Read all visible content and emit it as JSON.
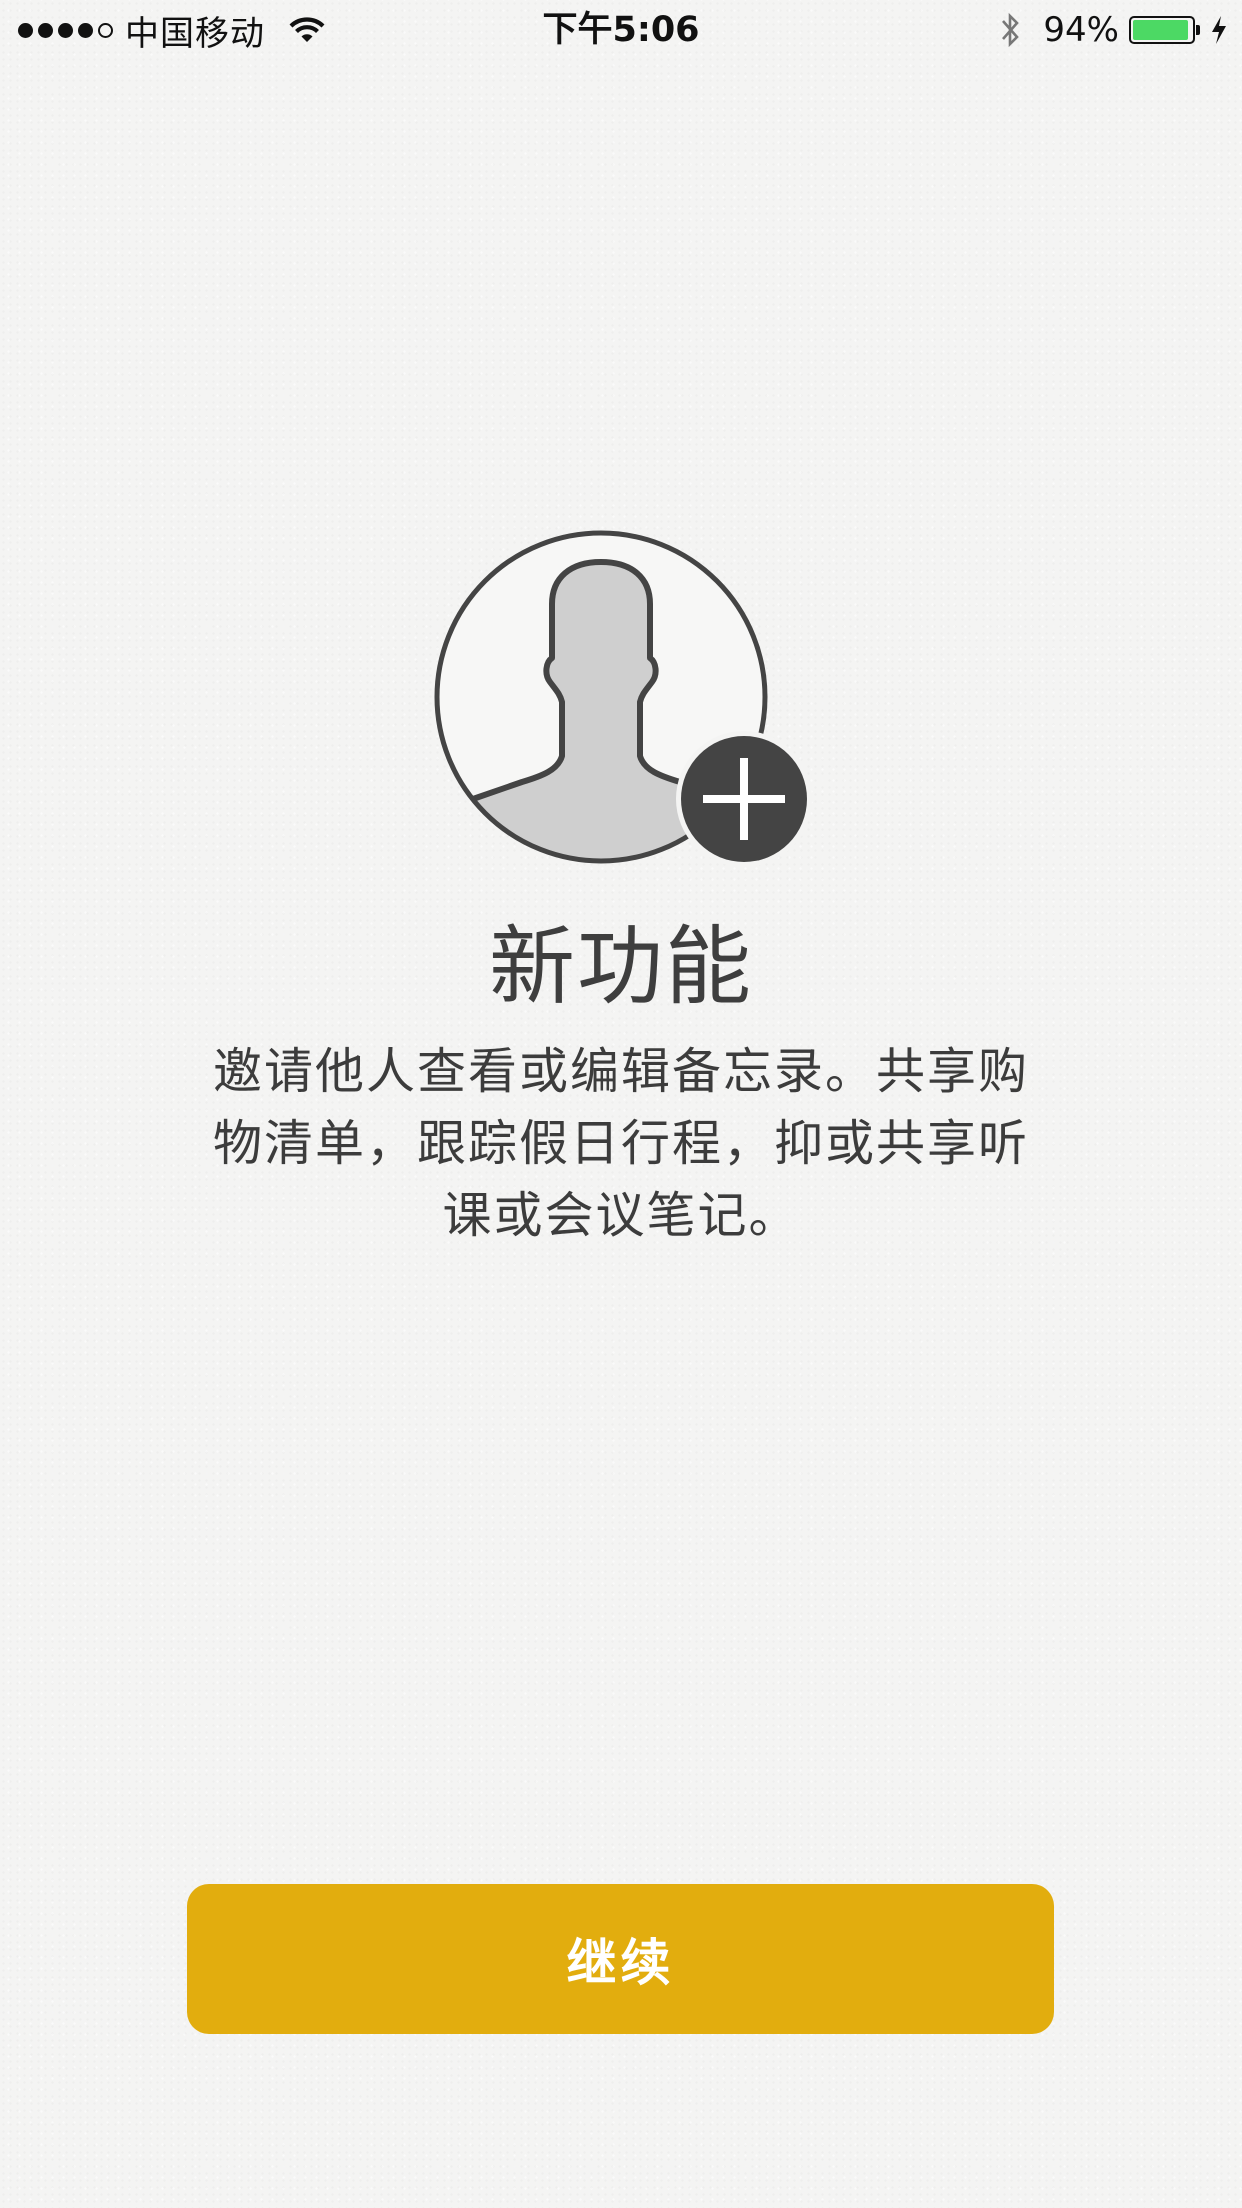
{
  "status_bar": {
    "carrier": "中国移动",
    "time": "下午5:06",
    "battery_percent": "94%",
    "battery_level": 0.94,
    "signal_bars_filled": 4,
    "signal_bars_total": 5,
    "icons": [
      "wifi-icon",
      "bluetooth-icon",
      "battery-icon",
      "charging-bolt-icon"
    ],
    "battery_color": "#4cd964"
  },
  "illustration": {
    "icon": "add-person-icon"
  },
  "content": {
    "title": "新功能",
    "description": "邀请他人查看或编辑备忘录。共享购物清单，跟踪假日行程，抑或共享听课或会议笔记。"
  },
  "actions": {
    "continue_label": "继续",
    "accent_color": "#e2ad0e"
  }
}
